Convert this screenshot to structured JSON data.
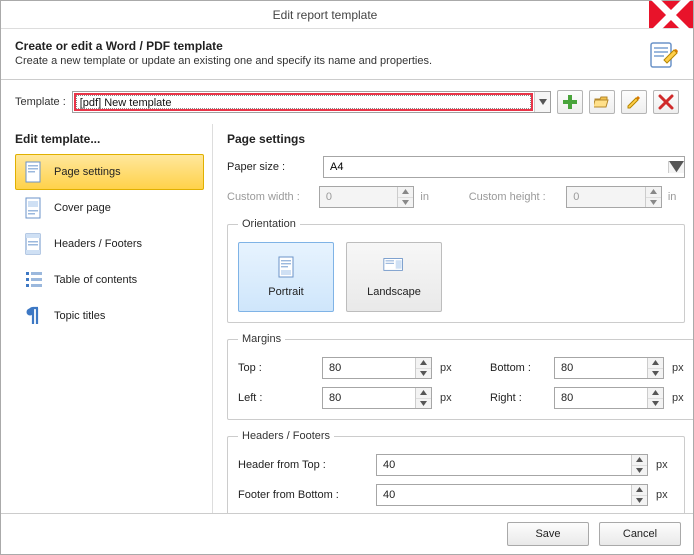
{
  "window": {
    "title": "Edit report template"
  },
  "header": {
    "title": "Create or edit a Word / PDF template",
    "desc": "Create a new template or update an existing one and specify its name and properties."
  },
  "template": {
    "label": "Template :",
    "value": "[pdf] New template"
  },
  "sidebar": {
    "title": "Edit template...",
    "items": [
      {
        "label": "Page settings"
      },
      {
        "label": "Cover page"
      },
      {
        "label": "Headers / Footers"
      },
      {
        "label": "Table of contents"
      },
      {
        "label": "Topic titles"
      }
    ]
  },
  "page": {
    "title": "Page settings",
    "paper_label": "Paper size :",
    "paper_value": "A4",
    "custom_w_label": "Custom width :",
    "custom_w_value": "0",
    "custom_h_label": "Custom height :",
    "custom_h_value": "0",
    "unit_in": "in",
    "orientation": {
      "legend": "Orientation",
      "portrait": "Portrait",
      "landscape": "Landscape"
    },
    "margins": {
      "legend": "Margins",
      "top": "Top :",
      "top_v": "80",
      "bottom": "Bottom :",
      "bottom_v": "80",
      "left": "Left :",
      "left_v": "80",
      "right": "Right :",
      "right_v": "80",
      "unit": "px"
    },
    "hf": {
      "legend": "Headers / Footers",
      "header_label": "Header from Top :",
      "header_v": "40",
      "footer_label": "Footer from Bottom :",
      "footer_v": "40",
      "unit": "px"
    }
  },
  "footer": {
    "save": "Save",
    "cancel": "Cancel"
  }
}
